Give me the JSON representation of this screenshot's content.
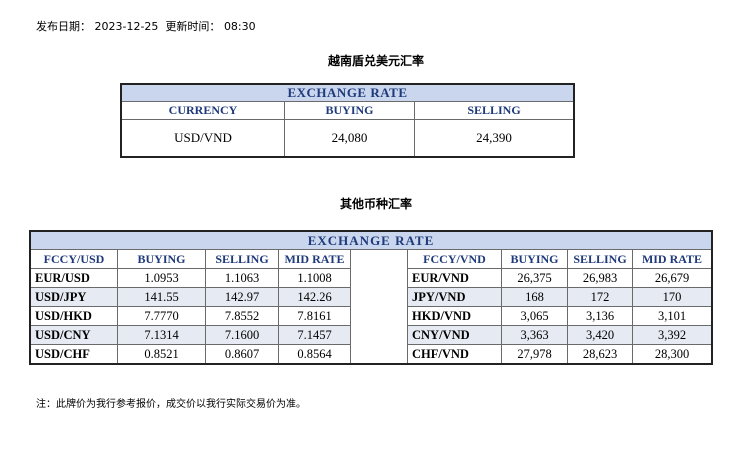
{
  "publish": {
    "label": "发布日期：",
    "date": "2023-12-25",
    "updated_label": "更新时间：",
    "time": "08:30"
  },
  "usd_vnd": {
    "title": "越南盾兑美元汇率",
    "header": "EXCHANGE RATE",
    "columns": [
      "CURRENCY",
      "BUYING",
      "SELLING"
    ],
    "row": {
      "currency": "USD/VND",
      "buying": "24,080",
      "selling": "24,390"
    }
  },
  "other": {
    "title": "其他币种汇率",
    "header": "EXCHANGE  RATE",
    "left_columns": [
      "FCCY/USD",
      "BUYING",
      "SELLING",
      "MID RATE"
    ],
    "right_columns": [
      "FCCY/VND",
      "BUYING",
      "SELLING",
      "MID RATE"
    ],
    "rows": [
      {
        "l_pair": "EUR/USD",
        "l_buy": "1.0953",
        "l_sell": "1.1063",
        "l_mid": "1.1008",
        "r_pair": "EUR/VND",
        "r_buy": "26,375",
        "r_sell": "26,983",
        "r_mid": "26,679"
      },
      {
        "l_pair": "USD/JPY",
        "l_buy": "141.55",
        "l_sell": "142.97",
        "l_mid": "142.26",
        "r_pair": "JPY/VND",
        "r_buy": "168",
        "r_sell": "172",
        "r_mid": "170"
      },
      {
        "l_pair": "USD/HKD",
        "l_buy": "7.7770",
        "l_sell": "7.8552",
        "l_mid": "7.8161",
        "r_pair": "HKD/VND",
        "r_buy": "3,065",
        "r_sell": "3,136",
        "r_mid": "3,101"
      },
      {
        "l_pair": "USD/CNY",
        "l_buy": "7.1314",
        "l_sell": "7.1600",
        "l_mid": "7.1457",
        "r_pair": "CNY/VND",
        "r_buy": "3,363",
        "r_sell": "3,420",
        "r_mid": "3,392"
      },
      {
        "l_pair": "USD/CHF",
        "l_buy": "0.8521",
        "l_sell": "0.8607",
        "l_mid": "0.8564",
        "r_pair": "CHF/VND",
        "r_buy": "27,978",
        "r_sell": "28,623",
        "r_mid": "28,300"
      }
    ]
  },
  "footnote": "注：此牌价为我行参考报价，成交价以我行实际交易价为准。"
}
